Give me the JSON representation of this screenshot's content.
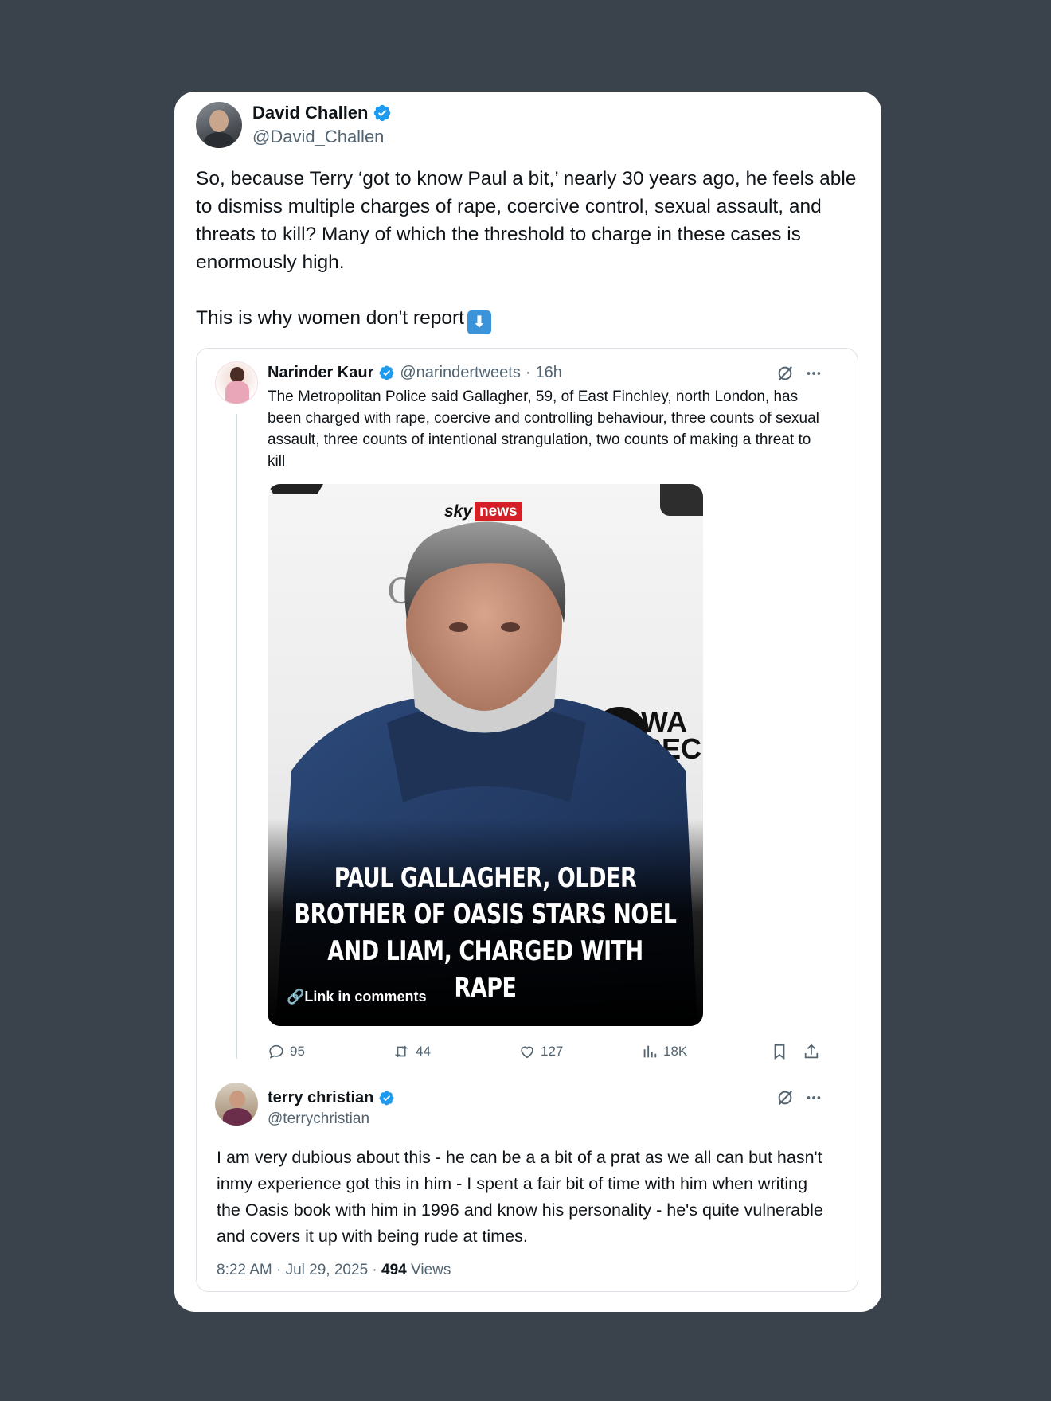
{
  "tweet": {
    "author_name": "David Challen",
    "author_handle": "@David_Challen",
    "text_main": "So, because Terry ‘got to know Paul a bit,’ nearly 30 years ago, he feels able to dismiss multiple charges of rape, coercive control, sexual assault, and threats to kill? Many of which the threshold to charge in these cases is enormously high.\n\nThis is why women don't report",
    "emoji": "⬇"
  },
  "quoted": {
    "author_name": "Narinder Kaur",
    "author_handle": "@narindertweets",
    "age": "16h",
    "text": "The Metropolitan Police said Gallagher, 59, of East Finchley, north London, has been charged with rape, coercive and controlling behaviour, three counts of sexual assault, three counts of intentional strangulation, two counts of making a threat to kill",
    "media": {
      "brand_sky": "sky",
      "brand_news": "news",
      "background_letter": "C",
      "background_logo_text": "WA\nREC",
      "headline": "PAUL GALLAGHER, OLDER\nBROTHER OF OASIS STARS NOEL\nAND LIAM, CHARGED WITH RAPE",
      "link_label": "Link in comments"
    },
    "stats": {
      "replies": "95",
      "reposts": "44",
      "likes": "127",
      "views": "18K"
    }
  },
  "reply": {
    "author_name": "terry christian",
    "author_handle": "@terrychristian",
    "text": "I am very dubious about this - he can be a a bit of a prat as we all can but hasn't inmy experience got this in him - I spent a fair bit of time with him when writing the Oasis book with him in 1996 and know his personality - he's quite vulnerable and covers it up with being rude at times.",
    "time": "8:22 AM",
    "date": "Jul 29, 2025",
    "views_count": "494",
    "views_label": "Views"
  },
  "colors": {
    "background": "#3a424c",
    "verified_blue": "#1d9bf0",
    "secondary_text": "#536471",
    "sky_news_red": "#d41f26"
  },
  "icons": [
    "verified-badge-icon",
    "grok-icon",
    "more-icon",
    "reply-icon",
    "repost-icon",
    "like-icon",
    "views-icon",
    "bookmark-icon",
    "share-icon",
    "link-icon",
    "down-arrow-emoji"
  ]
}
